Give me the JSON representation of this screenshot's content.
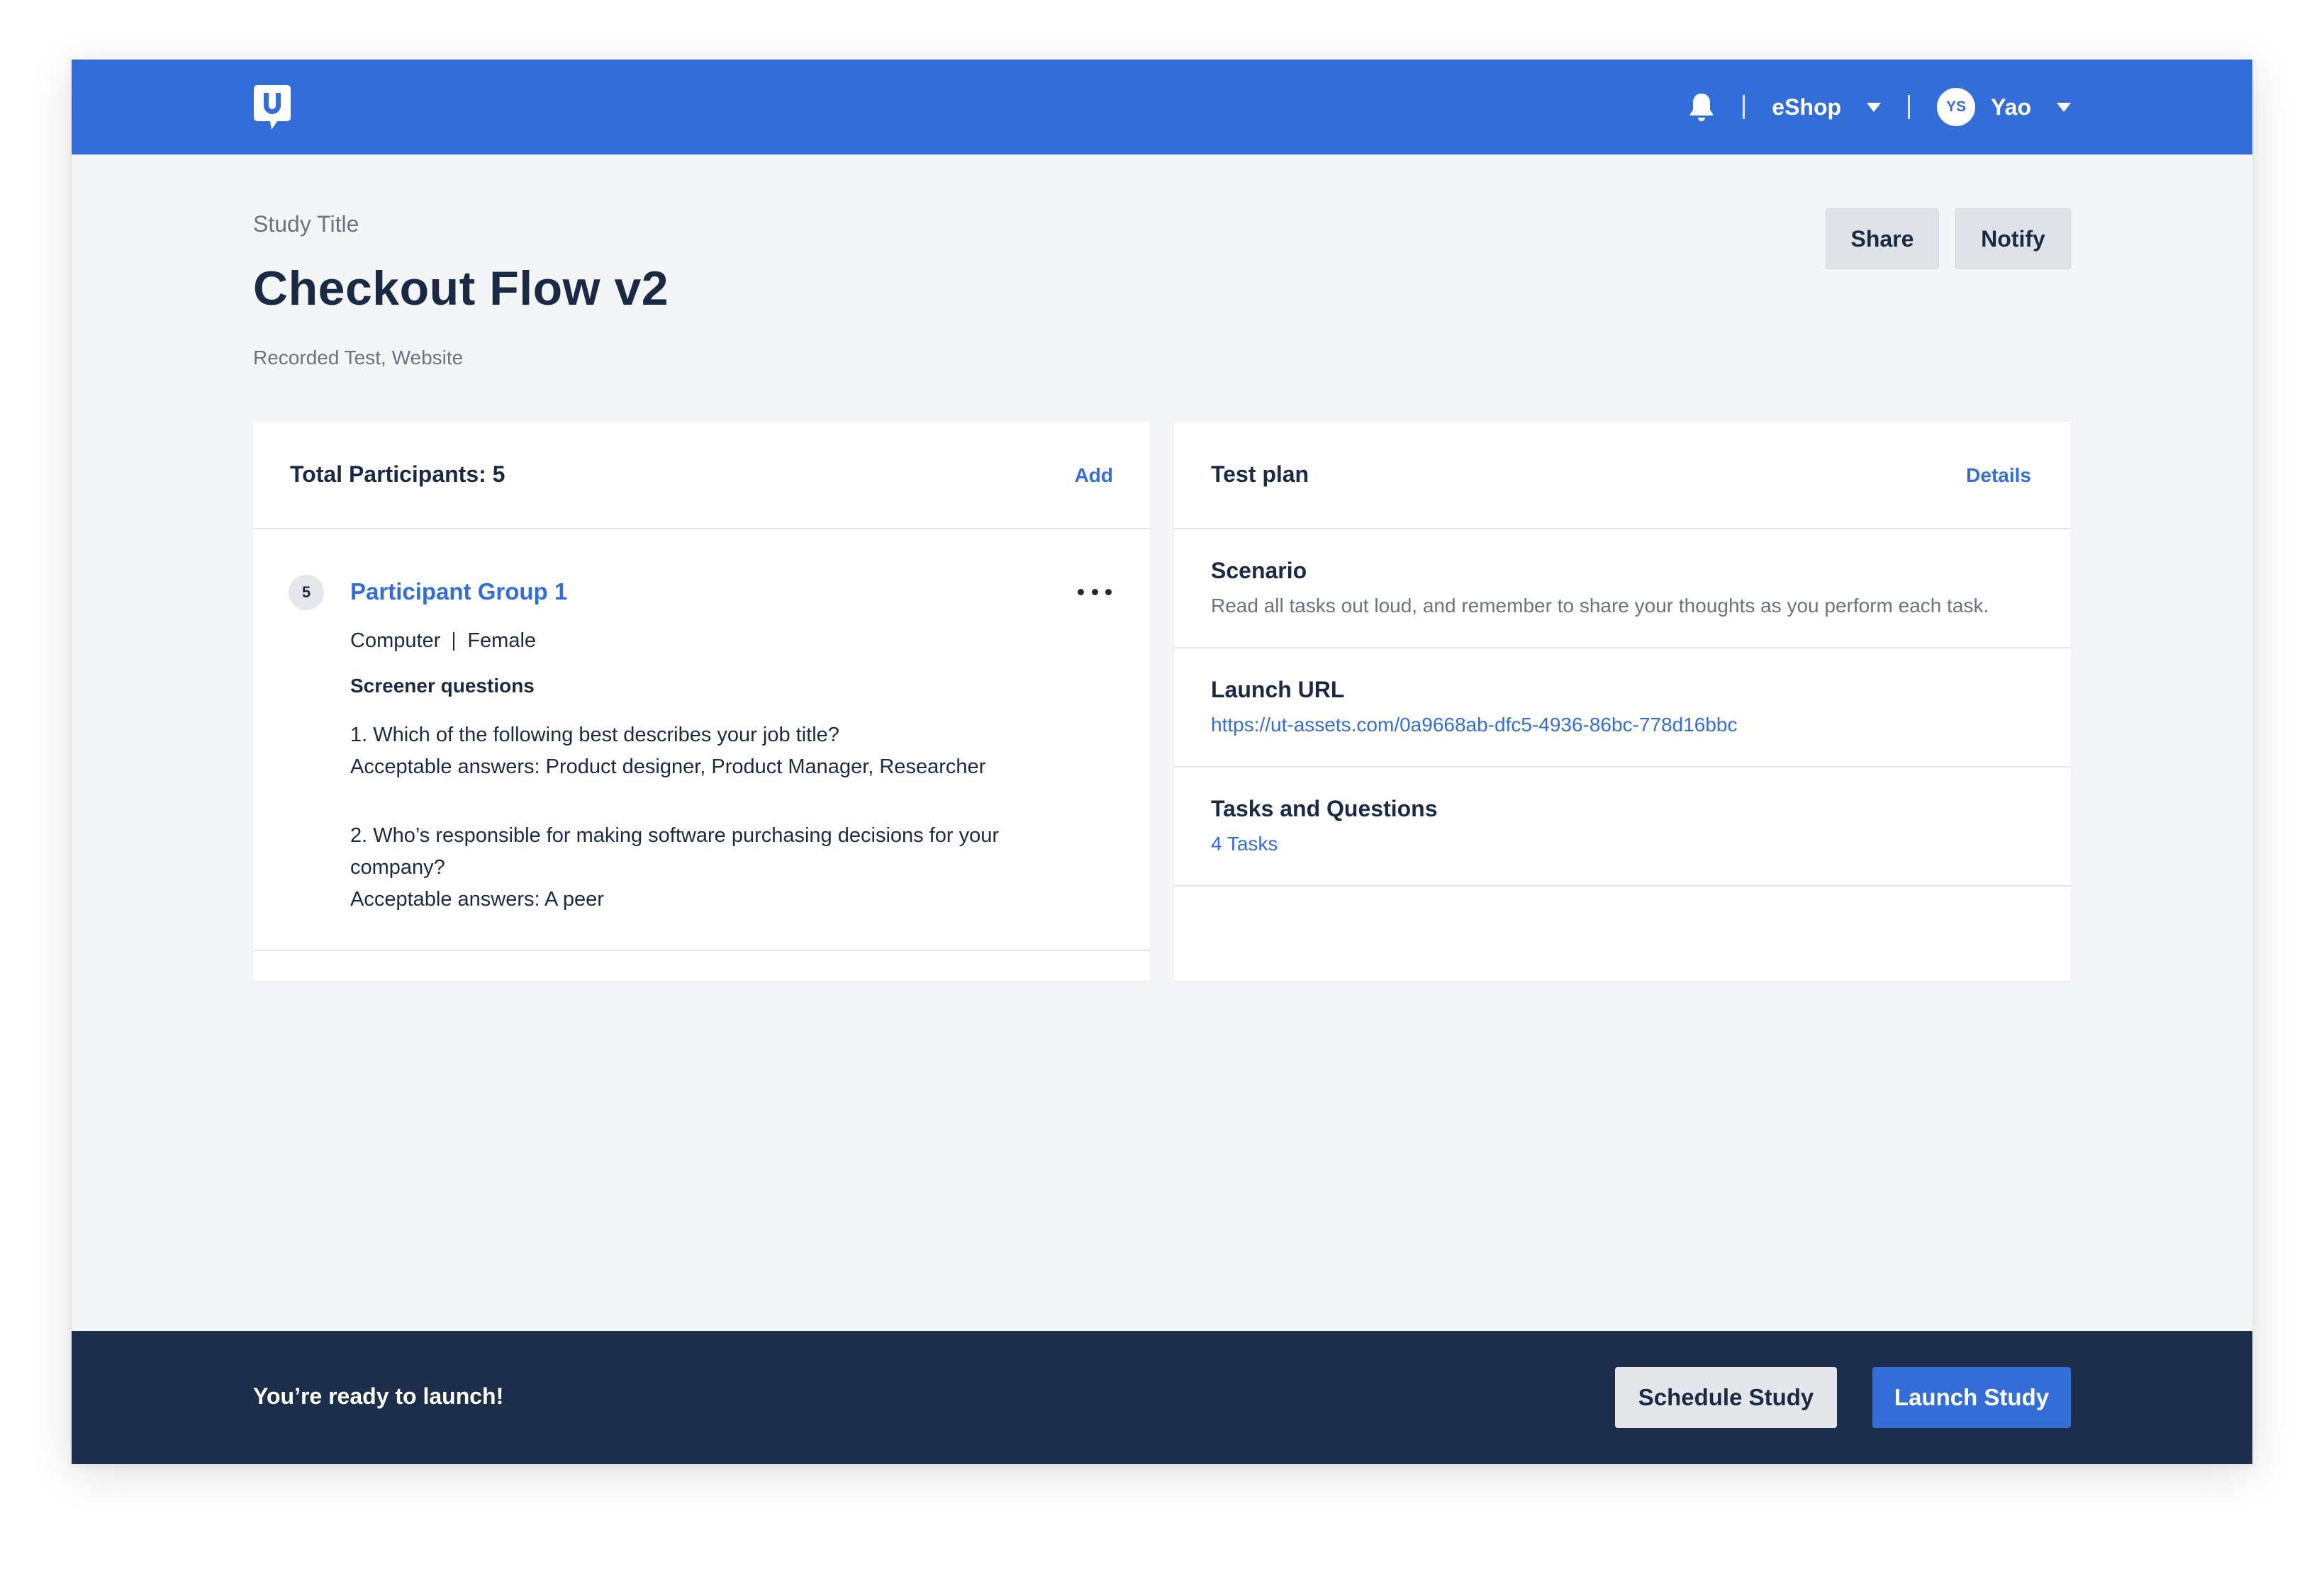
{
  "header": {
    "logo_icon": "usertesting-logo-icon",
    "notification_icon": "bell-icon",
    "workspace_label": "eShop",
    "user_initials": "YS",
    "user_name": "Yao",
    "accent_color": "#336ed8"
  },
  "study": {
    "label": "Study Title",
    "title": "Checkout Flow v2",
    "subtitle": "Recorded Test, Website",
    "share_label": "Share",
    "notify_label": "Notify"
  },
  "participants": {
    "title": "Total Participants: 5",
    "add_label": "Add",
    "group": {
      "count": "5",
      "name": "Participant Group 1",
      "device": "Computer",
      "gender": "Female",
      "screener_title": "Screener questions",
      "questions": [
        {
          "question": "1. Which of the following best describes your job title?",
          "answers": "Acceptable answers: Product designer, Product Manager, Researcher"
        },
        {
          "question": "2. Who’s responsible for making software purchasing decisions for your company?",
          "answers": "Acceptable answers: A peer"
        }
      ]
    }
  },
  "test_plan": {
    "title": "Test plan",
    "details_label": "Details",
    "scenario_title": "Scenario",
    "scenario_text": "Read all tasks out loud, and remember to share your thoughts as you perform each task.",
    "launch_url_title": "Launch URL",
    "launch_url": "https://ut-assets.com/0a9668ab-dfc5-4936-86bc-778d16bbc",
    "tasks_title": "Tasks and Questions",
    "tasks_count": "4 Tasks"
  },
  "footer": {
    "message": "You’re ready to launch!",
    "schedule_label": "Schedule Study",
    "launch_label": "Launch Study",
    "background_color": "#1c2e4a"
  }
}
